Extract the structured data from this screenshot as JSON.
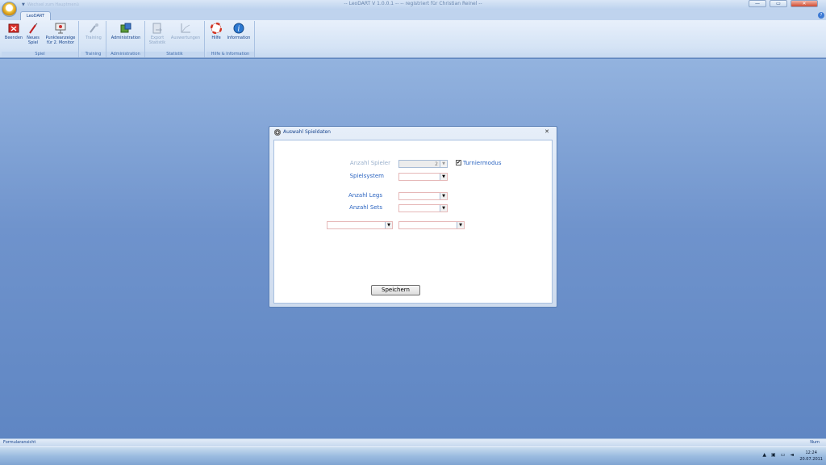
{
  "window": {
    "title": "-- LeoDART V 1.0.0.1 --  -- registriert für Christian Reinel --",
    "qat_text": "Wechsel zum Hauptmenü",
    "min": "—",
    "max": "▭",
    "close": "✕"
  },
  "ribbon": {
    "tab": "LeoDART",
    "groups": [
      {
        "label": "Spiel",
        "buttons": [
          {
            "label": "Beenden"
          },
          {
            "label": "Neues\nSpiel"
          },
          {
            "label": "Punkteanzeige\nfür 2. Monitor"
          }
        ]
      },
      {
        "label": "Training",
        "buttons": [
          {
            "label": "Training"
          }
        ]
      },
      {
        "label": "Administration",
        "buttons": [
          {
            "label": "Administration"
          }
        ]
      },
      {
        "label": "Statistik",
        "buttons": [
          {
            "label": "Export\nStatistik"
          },
          {
            "label": "Auswertungen"
          }
        ]
      },
      {
        "label": "Hilfe & Information",
        "buttons": [
          {
            "label": "Hilfe"
          },
          {
            "label": "Information"
          }
        ]
      }
    ]
  },
  "dialog": {
    "title": "Auswahl Spieldaten",
    "close": "✕",
    "anzahl_spieler_label": "Anzahl Spieler",
    "anzahl_spieler_value": "2",
    "turniermodus_label": "Turniermodus",
    "turniermodus_checked": "✔",
    "spielsystem_label": "Spielsystem",
    "anzahl_legs_label": "Anzahl Legs",
    "anzahl_sets_label": "Anzahl Sets",
    "save_label": "Speichern"
  },
  "statusbar": {
    "left": "Formularansicht",
    "right": "Num"
  },
  "taskbar": {
    "time": "12:24",
    "date": "20.07.2011"
  }
}
